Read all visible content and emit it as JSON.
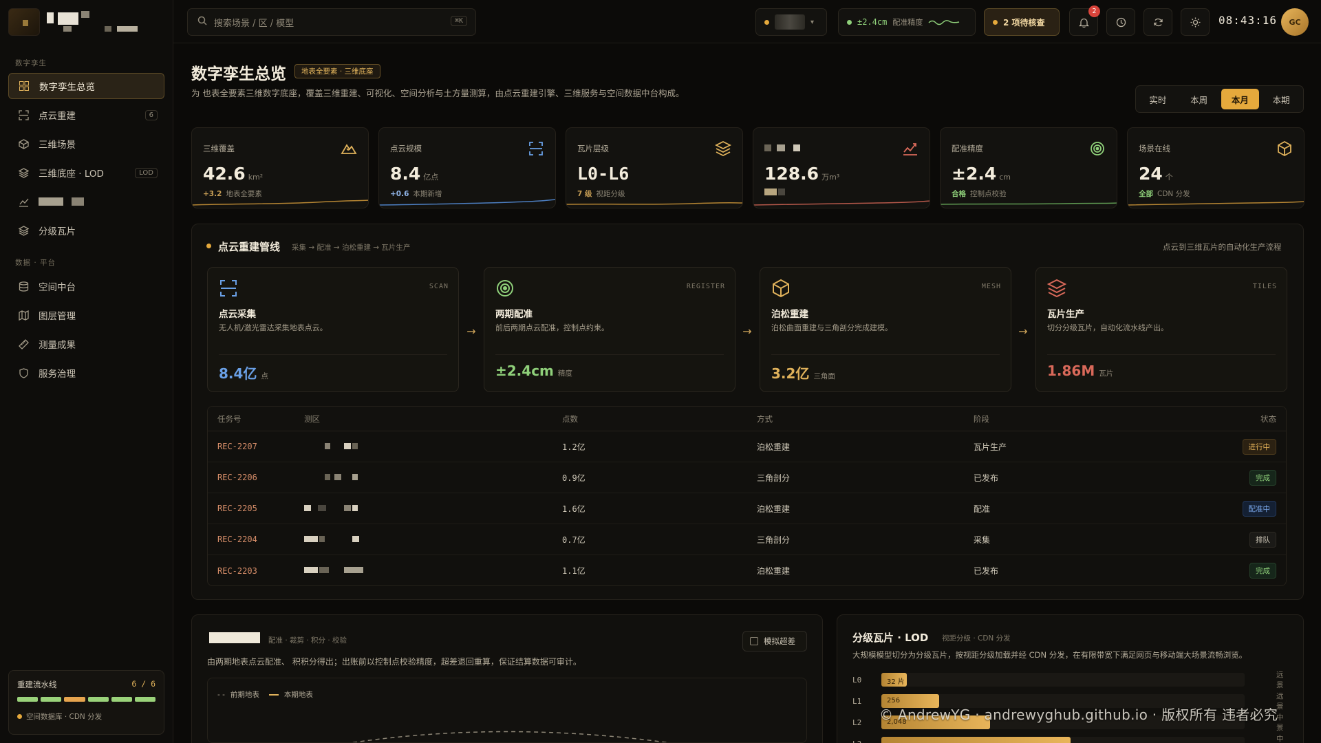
{
  "sidebar": {
    "section_twin": "数字孪生",
    "section_data": "数据 · 平台",
    "items": [
      {
        "label": "数字孪生总览",
        "badge": ""
      },
      {
        "label": "点云重建",
        "badge": "6"
      },
      {
        "label": "三维场景",
        "badge": ""
      },
      {
        "label": "三维底座 · LOD",
        "badge": "LOD"
      },
      {
        "label": "",
        "badge": ""
      },
      {
        "label": "分级瓦片",
        "badge": ""
      },
      {
        "label": "空间中台",
        "badge": ""
      },
      {
        "label": "图层管理",
        "badge": ""
      },
      {
        "label": "测量成果",
        "badge": ""
      },
      {
        "label": "服务治理",
        "badge": ""
      }
    ],
    "pipeline": {
      "title": "重建流水线",
      "count": "6 / 6",
      "footer": "空间数据库 · CDN 分发"
    }
  },
  "topbar": {
    "search_placeholder": "搜索场景 /        区 / 模型",
    "search_kbd": "⌘K",
    "accuracy_value": "±2.4cm",
    "accuracy_label": "配准精度",
    "pending": "2 项待核查",
    "notif_count": "2",
    "clock": "08:43:16",
    "avatar": "GC"
  },
  "header": {
    "title": "数字孪生总览",
    "tag": "地表全要素 · 三维底座",
    "desc": "为        也表全要素三维数字底座，覆盖三维重建、可视化、空间分析与土方量测算，由点云重建引擎、三维服务与空间数据中台构成。",
    "periods": [
      "实时",
      "本周",
      "本月",
      "本期"
    ],
    "active_period": 2
  },
  "kpis": [
    {
      "label": "三维覆盖",
      "value": "42.6",
      "unit": "km²",
      "delta": "+3.2",
      "note": "地表全要素",
      "icon": "mountain-icon",
      "color": "#e0b25b"
    },
    {
      "label": "点云规模",
      "value": "8.4",
      "unit": "亿点",
      "delta": "+0.6",
      "note": "本期新增",
      "icon": "scan-icon",
      "color": "#6aa0e6"
    },
    {
      "label": "瓦片层级",
      "value": "L0-L6",
      "unit": "",
      "delta": "7 级",
      "note": "视距分级",
      "icon": "layers-icon",
      "color": "#e0b25b"
    },
    {
      "label": "",
      "value": "128.6",
      "unit": "万m³",
      "delta": "",
      "note": "",
      "icon": "chart-icon",
      "color": "#d9695a"
    },
    {
      "label": "配准精度",
      "value": "±2.4",
      "unit": "cm",
      "delta": "合格",
      "note": "控制点校验",
      "icon": "target-icon",
      "color": "#8fd07a"
    },
    {
      "label": "场景在线",
      "value": "24",
      "unit": "个",
      "delta": "全部",
      "note": "CDN 分发",
      "icon": "cube-icon",
      "color": "#e0b25b"
    }
  ],
  "pipeline_panel": {
    "title": "点云重建管线",
    "crumbs": "采集 → 配准 → 泊松重建 → 瓦片生产",
    "note": "点云到三维瓦片的自动化生产流程",
    "stages": [
      {
        "code": "SCAN",
        "name": "点云采集",
        "desc": "无人机/激光雷达采集地表点云。",
        "metric": "8.4亿",
        "metric_unit": "点",
        "color": "#6aa0e6",
        "icon": "scan-icon"
      },
      {
        "code": "REGISTER",
        "name": "两期配准",
        "desc": "前后两期点云配准，控制点约束。",
        "metric": "±2.4cm",
        "metric_unit": "精度",
        "color": "#8fd07a",
        "icon": "target-icon"
      },
      {
        "code": "MESH",
        "name": "泊松重建",
        "desc": "泊松曲面重建与三角剖分完成建模。",
        "metric": "3.2亿",
        "metric_unit": "三角面",
        "color": "#e0b25b",
        "icon": "cube-icon"
      },
      {
        "code": "TILES",
        "name": "瓦片生产",
        "desc": "切分分级瓦片，自动化流水线产出。",
        "metric": "1.86M",
        "metric_unit": "瓦片",
        "color": "#d9695a",
        "icon": "layers-icon"
      }
    ]
  },
  "table": {
    "headers": [
      "任务号",
      "测区",
      "点数",
      "方式",
      "阶段",
      "状态"
    ],
    "rows": [
      {
        "id": "REC-2207",
        "points": "1.2亿",
        "method": "泊松重建",
        "stage": "瓦片生产",
        "status": "进行中",
        "kind": "run"
      },
      {
        "id": "REC-2206",
        "points": "0.9亿",
        "method": "三角剖分",
        "stage": "已发布",
        "status": "完成",
        "kind": "done"
      },
      {
        "id": "REC-2205",
        "points": "1.6亿",
        "method": "泊松重建",
        "stage": "配准",
        "status": "配准中",
        "kind": "reg"
      },
      {
        "id": "REC-2204",
        "points": "0.7亿",
        "method": "三角剖分",
        "stage": "采集",
        "status": "排队",
        "kind": "queue"
      },
      {
        "id": "REC-2203",
        "points": "1.1亿",
        "method": "泊松重建",
        "stage": "已发布",
        "status": "完成",
        "kind": "done"
      }
    ]
  },
  "earthwork_panel": {
    "crumbs": "配准 · 裁剪 · 积分 · 校验",
    "desc": "由两期地表点云配准、        积积分得出；出账前以控制点校验精度，超差退回重算，保证结算数据可审计。",
    "checkbox": "模拟超差",
    "legend_prev": "前期地表",
    "legend_curr": "本期地表"
  },
  "lod_panel": {
    "title": "分级瓦片 · LOD",
    "crumbs": "视距分级 · CDN 分发",
    "desc": "大规模模型切分为分级瓦片，按视距分级加载并经 CDN 分发，在有限带宽下满足网页与移动端大场景流畅浏览。",
    "levels": [
      {
        "level": "L0",
        "count": "32",
        "label": "32 片",
        "fraction": 0.07,
        "tag": "远景"
      },
      {
        "level": "L1",
        "count": "256",
        "label": "256",
        "fraction": 0.16,
        "tag": "远景"
      },
      {
        "level": "L2",
        "count": "2,048",
        "label": "2,048",
        "fraction": 0.3,
        "tag": "中景"
      },
      {
        "level": "L3",
        "count": "",
        "label": "",
        "fraction": 0.52,
        "tag": "中景"
      }
    ]
  },
  "watermark": "© AndrewYG · andrewyghub.github.io · 版权所有 违者必究"
}
